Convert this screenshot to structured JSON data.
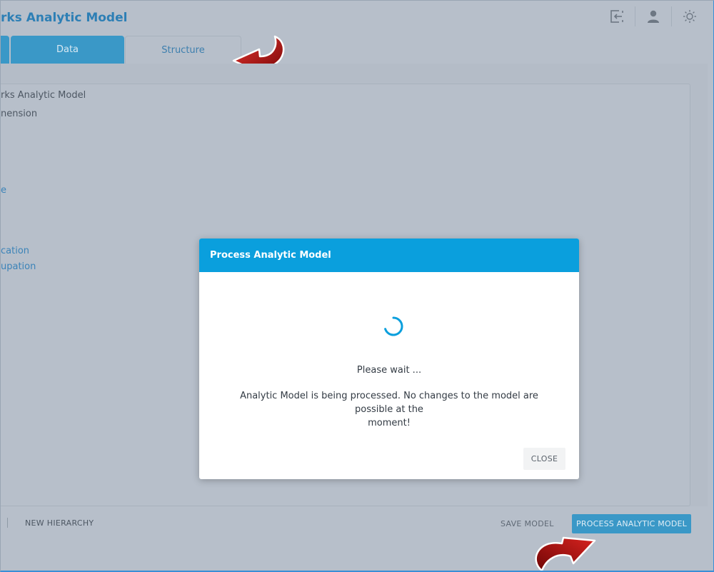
{
  "header": {
    "title": "rks Analytic Model",
    "icons": [
      "logout-icon",
      "user-icon",
      "lightbulb-icon"
    ]
  },
  "tabs": {
    "data_label": "Data",
    "structure_label": "Structure"
  },
  "tree": {
    "items": [
      "rks Analytic Model",
      "nension",
      "e",
      "cation",
      "upation"
    ]
  },
  "footer": {
    "new_hierarchy_label": "NEW HIERARCHY",
    "save_model_label": "SAVE MODEL",
    "process_label": "PROCESS ANALYTIC MODEL"
  },
  "dialog": {
    "title": "Process Analytic Model",
    "wait_text": "Please wait ...",
    "message_line1": "Analytic Model is being processed. No changes to the model are possible at the",
    "message_line2": "moment!",
    "close_label": "CLOSE"
  },
  "colors": {
    "accent": "#0a9fdd",
    "tab_active": "#3a98c7",
    "arrow_red": "#b50d0d",
    "overlay": "#b7bfca"
  }
}
